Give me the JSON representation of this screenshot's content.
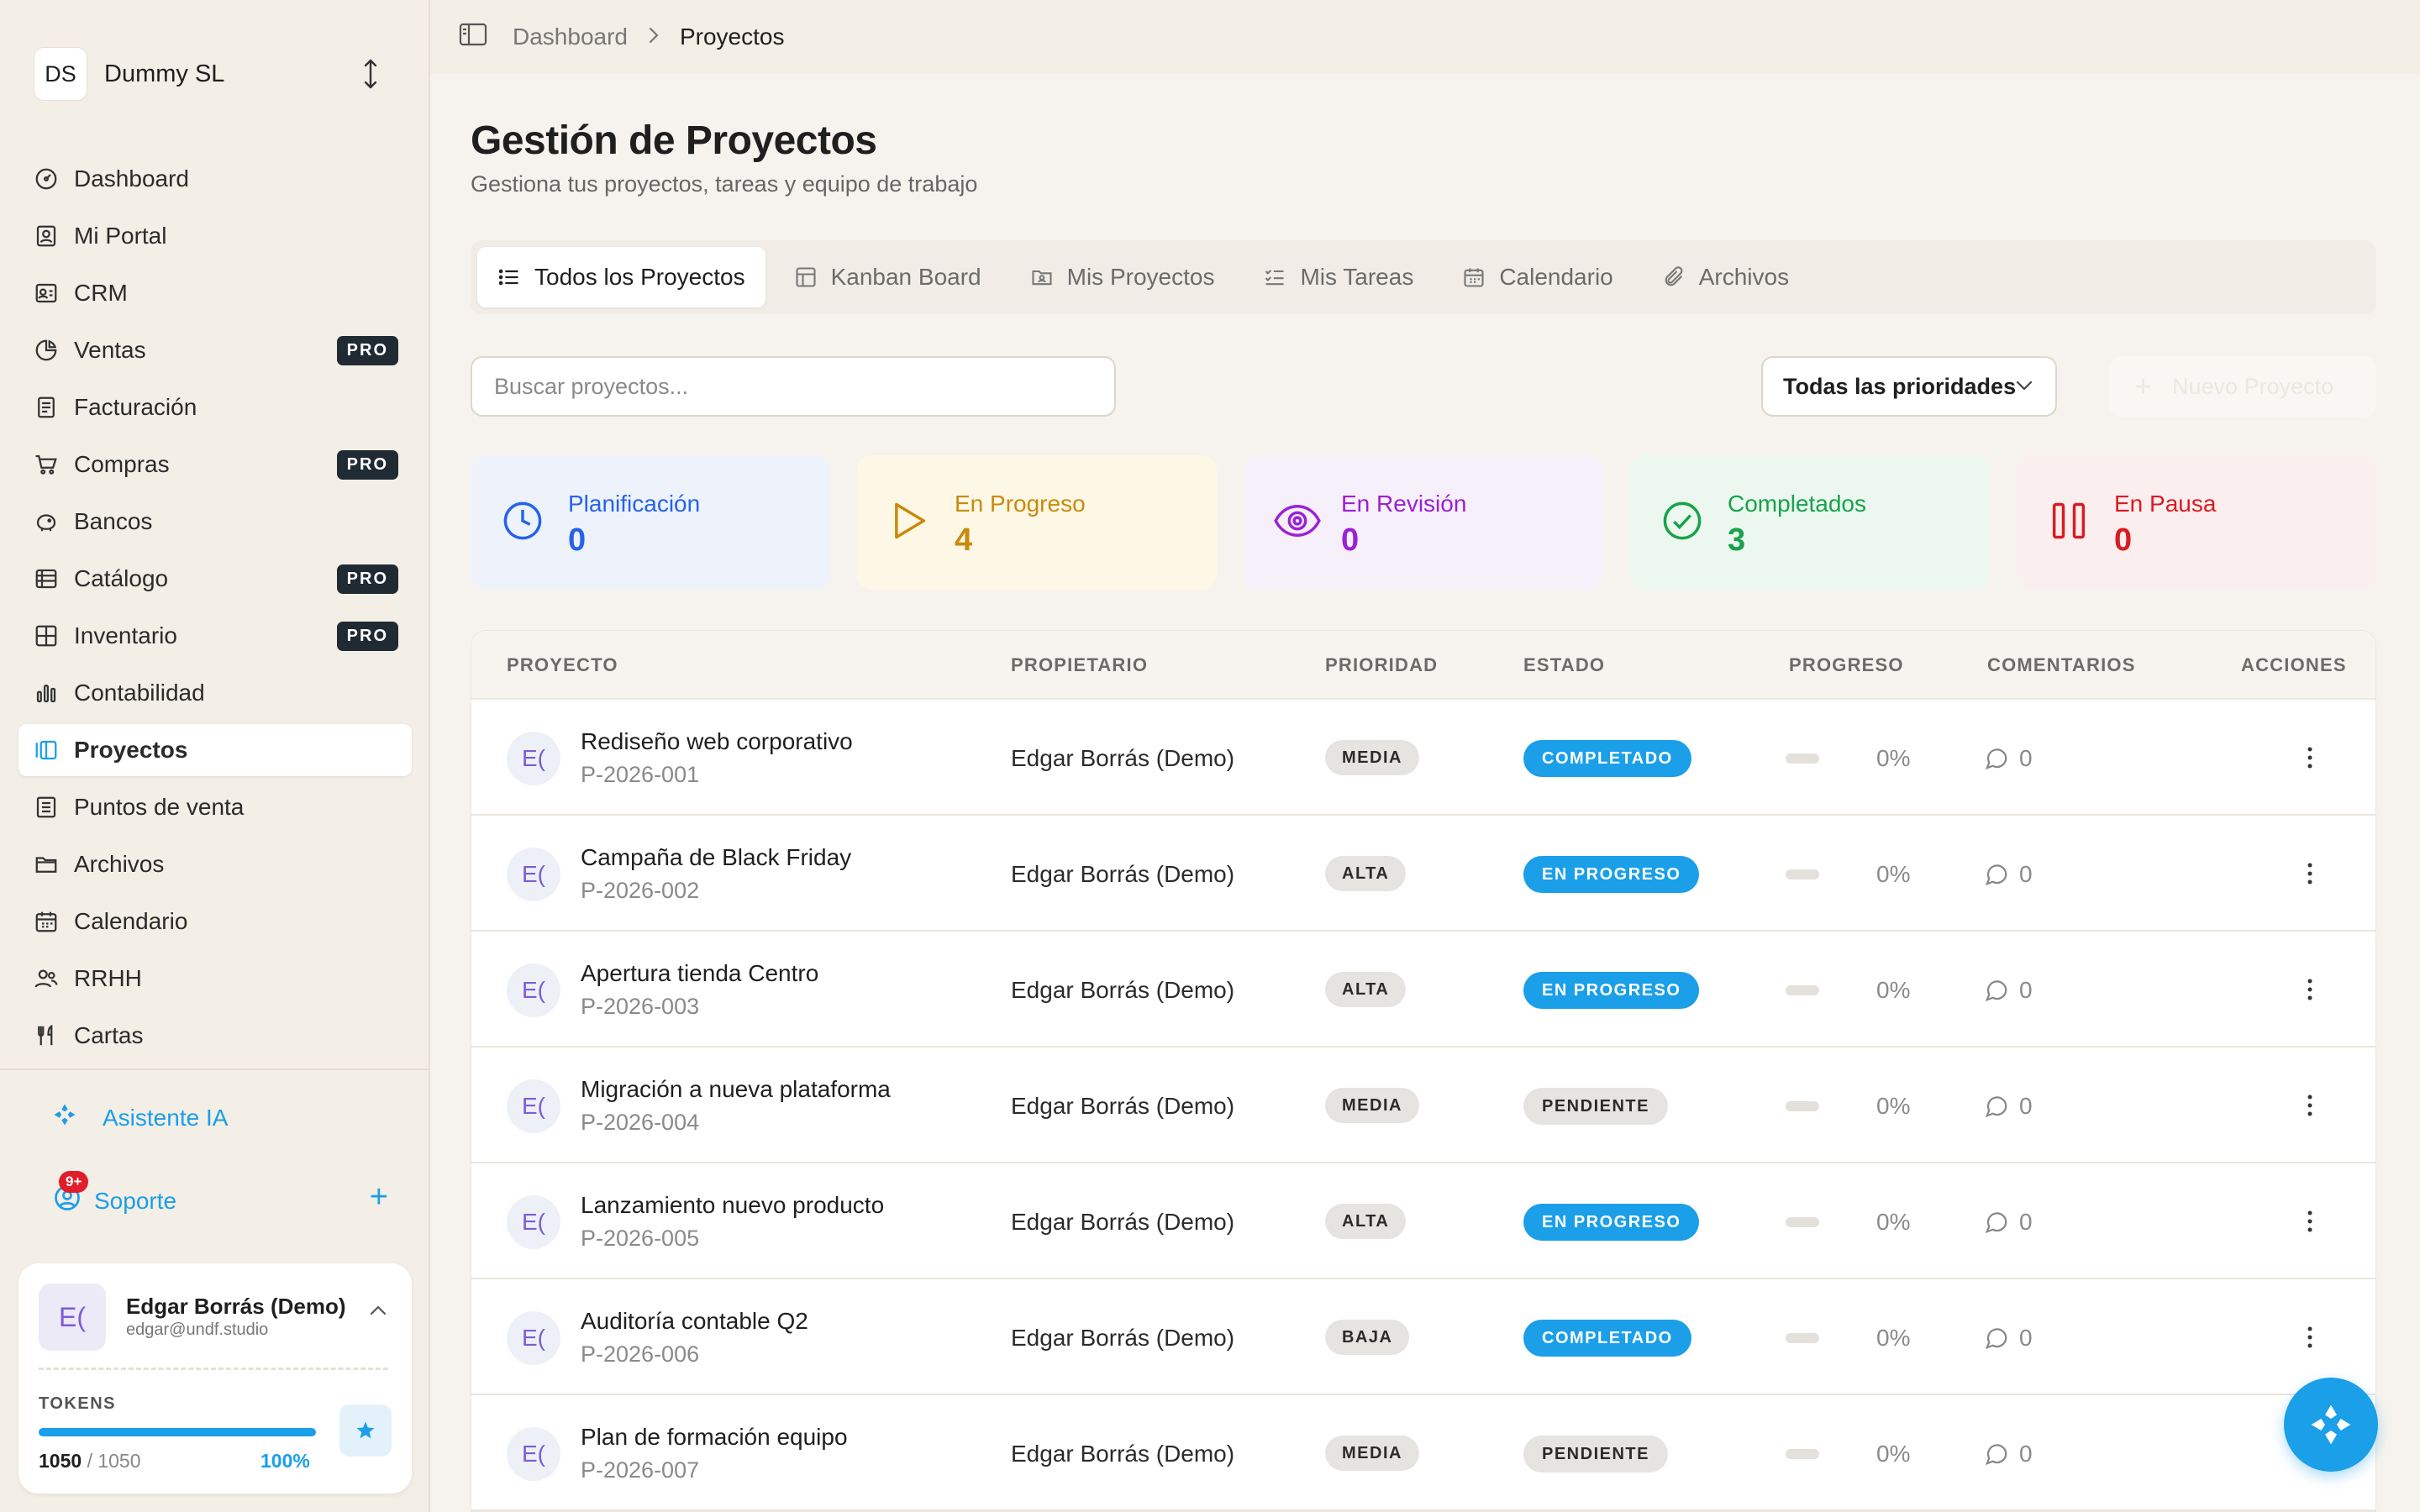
{
  "org": {
    "initials": "DS",
    "name": "Dummy SL"
  },
  "nav": [
    {
      "label": "Dashboard",
      "icon": "dashboard-icon",
      "pro": false,
      "active": false
    },
    {
      "label": "Mi Portal",
      "icon": "portal-icon",
      "pro": false,
      "active": false
    },
    {
      "label": "CRM",
      "icon": "crm-icon",
      "pro": false,
      "active": false
    },
    {
      "label": "Ventas",
      "icon": "sales-icon",
      "pro": true,
      "active": false
    },
    {
      "label": "Facturación",
      "icon": "invoice-icon",
      "pro": false,
      "active": false
    },
    {
      "label": "Compras",
      "icon": "cart-icon",
      "pro": true,
      "active": false
    },
    {
      "label": "Bancos",
      "icon": "bank-icon",
      "pro": false,
      "active": false
    },
    {
      "label": "Catálogo",
      "icon": "catalog-icon",
      "pro": true,
      "active": false
    },
    {
      "label": "Inventario",
      "icon": "inventory-icon",
      "pro": true,
      "active": false
    },
    {
      "label": "Contabilidad",
      "icon": "accounting-icon",
      "pro": false,
      "active": false
    },
    {
      "label": "Proyectos",
      "icon": "projects-icon",
      "pro": false,
      "active": true
    },
    {
      "label": "Puntos de venta",
      "icon": "pos-icon",
      "pro": false,
      "active": false
    },
    {
      "label": "Archivos",
      "icon": "folder-icon",
      "pro": false,
      "active": false
    },
    {
      "label": "Calendario",
      "icon": "calendar-icon",
      "pro": false,
      "active": false
    },
    {
      "label": "RRHH",
      "icon": "people-icon",
      "pro": false,
      "active": false
    },
    {
      "label": "Cartas",
      "icon": "utensils-icon",
      "pro": false,
      "active": false
    }
  ],
  "pro_label": "PRO",
  "assistant_label": "Asistente IA",
  "support": {
    "label": "Soporte",
    "badge": "9+"
  },
  "user": {
    "initials": "E(",
    "name": "Edgar Borrás (Demo)",
    "email": "edgar@undf.studio",
    "tokens_label": "TOKENS",
    "tokens_used": "1050",
    "tokens_total": "/ 1050",
    "tokens_pct": "100%",
    "tokens_fraction": 1.0
  },
  "breadcrumb": {
    "parent": "Dashboard",
    "current": "Proyectos"
  },
  "page": {
    "title": "Gestión de Proyectos",
    "subtitle": "Gestiona tus proyectos, tareas y equipo de trabajo"
  },
  "tabs": [
    {
      "label": "Todos los Proyectos",
      "icon": "list-icon",
      "active": true
    },
    {
      "label": "Kanban Board",
      "icon": "kanban-icon",
      "active": false
    },
    {
      "label": "Mis Proyectos",
      "icon": "user-folder-icon",
      "active": false
    },
    {
      "label": "Mis Tareas",
      "icon": "checklist-icon",
      "active": false
    },
    {
      "label": "Calendario",
      "icon": "calendar-icon",
      "active": false
    },
    {
      "label": "Archivos",
      "icon": "paperclip-icon",
      "active": false
    }
  ],
  "search": {
    "placeholder": "Buscar proyectos...",
    "value": ""
  },
  "priority_filter": {
    "value": "Todas las prioridades"
  },
  "new_project_label": "Nuevo Proyecto",
  "stats": [
    {
      "label": "Planificación",
      "value": "0",
      "icon": "clock-icon",
      "color": "#2563eb",
      "bg": "#edf2fb"
    },
    {
      "label": "En Progreso",
      "value": "4",
      "icon": "play-icon",
      "color": "#c98a0c",
      "bg": "#fdf8e6"
    },
    {
      "label": "En Revisión",
      "value": "0",
      "icon": "eye-icon",
      "color": "#9b21d6",
      "bg": "#f6f0fa"
    },
    {
      "label": "Completados",
      "value": "3",
      "icon": "check-circle-icon",
      "color": "#16a34a",
      "bg": "#ecf7ef"
    },
    {
      "label": "En Pausa",
      "value": "0",
      "icon": "pause-icon",
      "color": "#d91c22",
      "bg": "#fbeeee"
    }
  ],
  "table": {
    "headers": [
      "PROYECTO",
      "PROPIETARIO",
      "PRIORIDAD",
      "ESTADO",
      "PROGRESO",
      "COMENTARIOS",
      "ACCIONES"
    ],
    "rows": [
      {
        "initials": "E(",
        "name": "Rediseño web corporativo",
        "code": "P-2026-001",
        "owner": "Edgar Borrás (Demo)",
        "priority": "MEDIA",
        "status": "COMPLETADO",
        "status_kind": "done",
        "progress": "0%",
        "progress_fraction": 0,
        "comments": "0"
      },
      {
        "initials": "E(",
        "name": "Campaña de Black Friday",
        "code": "P-2026-002",
        "owner": "Edgar Borrás (Demo)",
        "priority": "ALTA",
        "status": "EN PROGRESO",
        "status_kind": "prog",
        "progress": "0%",
        "progress_fraction": 0,
        "comments": "0"
      },
      {
        "initials": "E(",
        "name": "Apertura tienda Centro",
        "code": "P-2026-003",
        "owner": "Edgar Borrás (Demo)",
        "priority": "ALTA",
        "status": "EN PROGRESO",
        "status_kind": "prog",
        "progress": "0%",
        "progress_fraction": 0,
        "comments": "0"
      },
      {
        "initials": "E(",
        "name": "Migración a nueva plataforma",
        "code": "P-2026-004",
        "owner": "Edgar Borrás (Demo)",
        "priority": "MEDIA",
        "status": "PENDIENTE",
        "status_kind": "pend",
        "progress": "0%",
        "progress_fraction": 0,
        "comments": "0"
      },
      {
        "initials": "E(",
        "name": "Lanzamiento nuevo producto",
        "code": "P-2026-005",
        "owner": "Edgar Borrás (Demo)",
        "priority": "ALTA",
        "status": "EN PROGRESO",
        "status_kind": "prog",
        "progress": "0%",
        "progress_fraction": 0,
        "comments": "0"
      },
      {
        "initials": "E(",
        "name": "Auditoría contable Q2",
        "code": "P-2026-006",
        "owner": "Edgar Borrás (Demo)",
        "priority": "BAJA",
        "status": "COMPLETADO",
        "status_kind": "done",
        "progress": "0%",
        "progress_fraction": 0,
        "comments": "0"
      },
      {
        "initials": "E(",
        "name": "Plan de formación equipo",
        "code": "P-2026-007",
        "owner": "Edgar Borrás (Demo)",
        "priority": "MEDIA",
        "status": "PENDIENTE",
        "status_kind": "pend",
        "progress": "0%",
        "progress_fraction": 0,
        "comments": "0"
      }
    ]
  },
  "colors": {
    "accent": "#1a9fe8",
    "sidebar_bg": "#f3eee6",
    "main_bg": "#f6f3ee"
  }
}
